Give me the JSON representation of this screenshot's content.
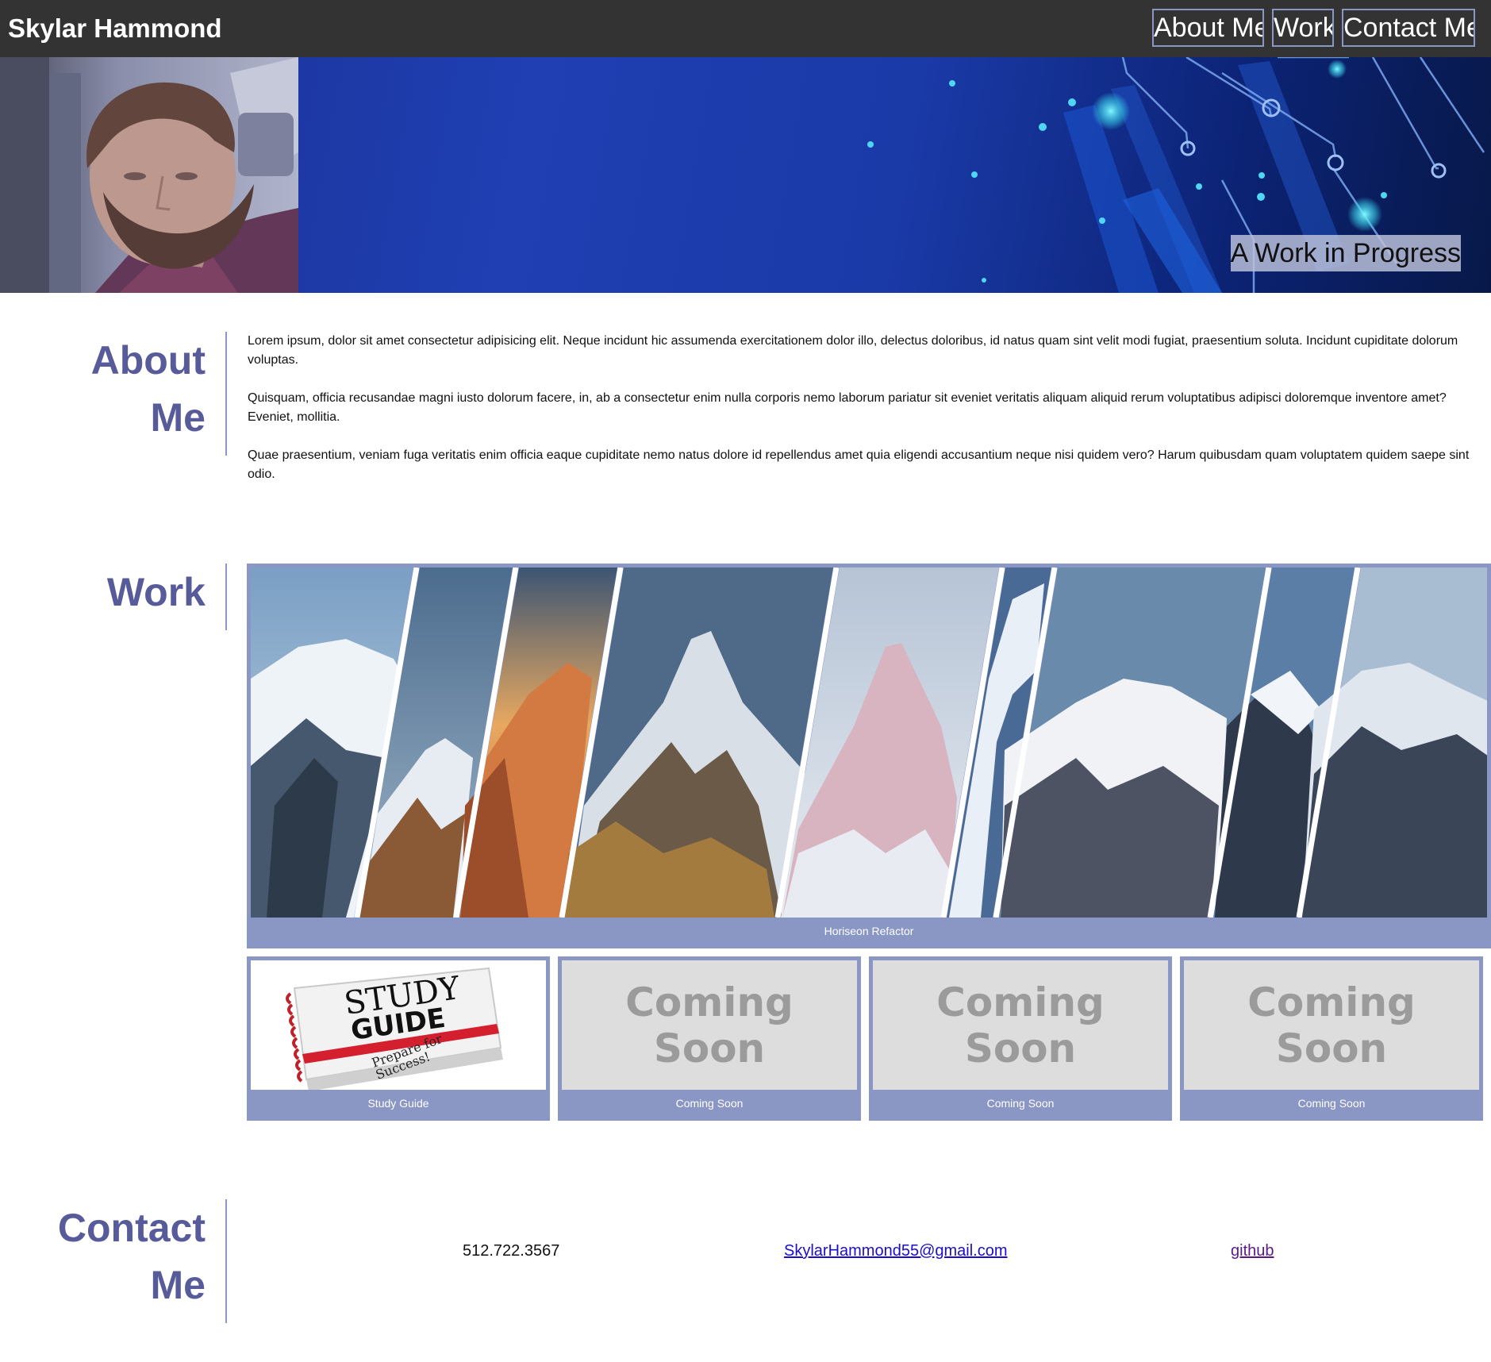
{
  "header": {
    "brand": "Skylar Hammond",
    "nav": [
      {
        "label": "About Me"
      },
      {
        "label": "Work"
      },
      {
        "label": "Contact Me"
      }
    ]
  },
  "hero": {
    "tagline": "A Work in Progress"
  },
  "about": {
    "heading_line1": "About",
    "heading_line2": "Me",
    "paragraphs": [
      "Lorem ipsum, dolor sit amet consectetur adipisicing elit. Neque incidunt hic assumenda exercitationem dolor illo, delectus doloribus, id natus quam sint velit modi fugiat, praesentium soluta. Incidunt cupiditate dolorum voluptas.",
      "Quisquam, officia recusandae magni iusto dolorum facere, in, ab a consectetur enim nulla corporis nemo laborum pariatur sit eveniet veritatis aliquam aliquid rerum voluptatibus adipisci doloremque inventore amet? Eveniet, mollitia.",
      "Quae praesentium, veniam fuga veritatis enim officia eaque cupiditate nemo natus dolore id repellendus amet quia eligendi accusantium neque nisi quidem vero? Harum quibusdam quam voluptatem quidem saepe sint odio."
    ]
  },
  "work": {
    "heading": "Work",
    "featured": {
      "caption": "Horiseon Refactor"
    },
    "projects": [
      {
        "caption": "Study Guide",
        "image_text_1": "STUDY",
        "image_text_2": "GUIDE",
        "image_text_3": "Prepare for",
        "image_text_4": "Success!"
      },
      {
        "caption": "Coming Soon",
        "image_line1": "Coming",
        "image_line2": "Soon"
      },
      {
        "caption": "Coming Soon",
        "image_line1": "Coming",
        "image_line2": "Soon"
      },
      {
        "caption": "Coming Soon",
        "image_line1": "Coming",
        "image_line2": "Soon"
      }
    ]
  },
  "contact": {
    "heading_line1": "Contact",
    "heading_line2": "Me",
    "phone": "512.722.3567",
    "email": "SkylarHammond55@gmail.com",
    "github": "github"
  },
  "colors": {
    "topbar": "#333333",
    "accent": "#585b99",
    "card_border": "#8a96c4",
    "hero_blue": "#1f3fb3"
  }
}
